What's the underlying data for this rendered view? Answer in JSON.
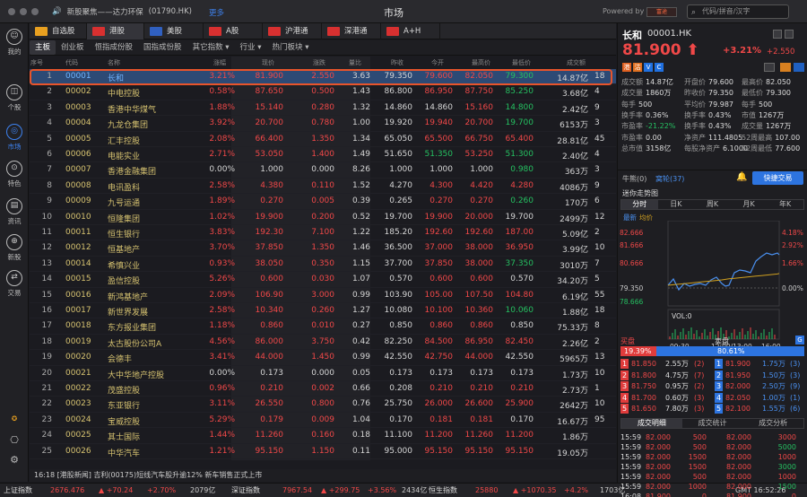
{
  "window": {
    "title": "市场",
    "ticker_prefix": "新股聚焦——",
    "ticker_name": "达力环保",
    "ticker_code": "(01790.HK)",
    "more": "更多",
    "powered": "Powered by",
    "brand": "富途",
    "search_placeholder": "代码/拼音/汉字"
  },
  "sidebar": [
    {
      "label": "我的",
      "icon": "avatar-icon"
    },
    {
      "label": "个股",
      "icon": "chart-icon"
    },
    {
      "label": "市场",
      "icon": "market-icon",
      "active": true
    },
    {
      "label": "特色",
      "icon": "special-icon"
    },
    {
      "label": "资讯",
      "icon": "news-icon"
    },
    {
      "label": "新股",
      "icon": "ipo-icon"
    },
    {
      "label": "交易",
      "icon": "trade-icon"
    }
  ],
  "market_tabs": [
    {
      "label": "自选股",
      "color": "#e8a020"
    },
    {
      "label": "港股",
      "color": "#d83030",
      "active": true
    },
    {
      "label": "美股",
      "color": "#3060c0"
    },
    {
      "label": "A股",
      "color": "#d83030"
    },
    {
      "label": "沪港通",
      "color": "#d83030"
    },
    {
      "label": "深港通",
      "color": "#d83030"
    },
    {
      "label": "A+H",
      "color": "#d83030"
    }
  ],
  "sub_tabs": [
    "主板",
    "创业板",
    "恒指成份股",
    "国指成份股",
    "其它指数 ▾",
    "行业 ▾",
    "热门板块 ▾"
  ],
  "table_headers": [
    "序号",
    "代码",
    "名称",
    "涨幅",
    "现价",
    "涨跌",
    "量比",
    "昨收",
    "今开",
    "最高价",
    "最低价",
    "成交额"
  ],
  "rows": [
    [
      "1",
      "00001",
      "长和",
      "3.21%",
      "81.900",
      "2.550",
      "3.63",
      "79.350",
      "79.600",
      "82.050",
      "79.300",
      "14.87亿",
      "18"
    ],
    [
      "2",
      "00002",
      "中电控股",
      "0.58%",
      "87.650",
      "0.500",
      "1.43",
      "86.800",
      "86.950",
      "87.750",
      "85.250",
      "3.68亿",
      "4"
    ],
    [
      "3",
      "00003",
      "香港中华煤气",
      "1.88%",
      "15.140",
      "0.280",
      "1.32",
      "14.860",
      "14.860",
      "15.160",
      "14.800",
      "2.42亿",
      "9"
    ],
    [
      "4",
      "00004",
      "九龙仓集团",
      "3.92%",
      "20.700",
      "0.780",
      "1.00",
      "19.920",
      "19.940",
      "20.700",
      "19.700",
      "6153万",
      "3"
    ],
    [
      "5",
      "00005",
      "汇丰控股",
      "2.08%",
      "66.400",
      "1.350",
      "1.34",
      "65.050",
      "65.500",
      "66.750",
      "65.400",
      "28.81亿",
      "45"
    ],
    [
      "6",
      "00006",
      "电能实业",
      "2.71%",
      "53.050",
      "1.400",
      "1.49",
      "51.650",
      "51.350",
      "53.250",
      "51.300",
      "2.40亿",
      "4"
    ],
    [
      "7",
      "00007",
      "香港金融集团",
      "0.00%",
      "1.000",
      "0.000",
      "8.26",
      "1.000",
      "1.000",
      "1.000",
      "0.980",
      "363万",
      "3"
    ],
    [
      "8",
      "00008",
      "电讯盈科",
      "2.58%",
      "4.380",
      "0.110",
      "1.52",
      "4.270",
      "4.300",
      "4.420",
      "4.280",
      "4086万",
      "9"
    ],
    [
      "9",
      "00009",
      "九号运通",
      "1.89%",
      "0.270",
      "0.005",
      "0.39",
      "0.265",
      "0.270",
      "0.270",
      "0.260",
      "170万",
      "6"
    ],
    [
      "10",
      "00010",
      "恒隆集团",
      "1.02%",
      "19.900",
      "0.200",
      "0.52",
      "19.700",
      "19.900",
      "20.000",
      "19.700",
      "2499万",
      "12"
    ],
    [
      "11",
      "00011",
      "恒生银行",
      "3.83%",
      "192.30",
      "7.100",
      "1.22",
      "185.20",
      "192.60",
      "192.60",
      "187.00",
      "5.09亿",
      "2"
    ],
    [
      "12",
      "00012",
      "恒基地产",
      "3.70%",
      "37.850",
      "1.350",
      "1.46",
      "36.500",
      "37.000",
      "38.000",
      "36.950",
      "3.99亿",
      "10"
    ],
    [
      "13",
      "00014",
      "希慎兴业",
      "0.93%",
      "38.050",
      "0.350",
      "1.15",
      "37.700",
      "37.850",
      "38.000",
      "37.350",
      "3010万",
      "7"
    ],
    [
      "14",
      "00015",
      "盈信控股",
      "5.26%",
      "0.600",
      "0.030",
      "1.07",
      "0.570",
      "0.600",
      "0.600",
      "0.570",
      "34.20万",
      "5"
    ],
    [
      "15",
      "00016",
      "新鸿基地产",
      "2.09%",
      "106.90",
      "3.000",
      "0.99",
      "103.90",
      "105.00",
      "107.50",
      "104.80",
      "6.19亿",
      "55"
    ],
    [
      "16",
      "00017",
      "新世界发展",
      "2.58%",
      "10.340",
      "0.260",
      "1.27",
      "10.080",
      "10.100",
      "10.360",
      "10.060",
      "1.88亿",
      "18"
    ],
    [
      "17",
      "00018",
      "东方报业集团",
      "1.18%",
      "0.860",
      "0.010",
      "0.27",
      "0.850",
      "0.860",
      "0.860",
      "0.850",
      "75.33万",
      "8"
    ],
    [
      "18",
      "00019",
      "太古股份公司A",
      "4.56%",
      "86.000",
      "3.750",
      "0.42",
      "82.250",
      "84.500",
      "86.950",
      "82.450",
      "2.26亿",
      "2"
    ],
    [
      "19",
      "00020",
      "会德丰",
      "3.41%",
      "44.000",
      "1.450",
      "0.99",
      "42.550",
      "42.750",
      "44.000",
      "42.550",
      "5965万",
      "13"
    ],
    [
      "20",
      "00021",
      "大中华地产控股",
      "0.00%",
      "0.173",
      "0.000",
      "0.05",
      "0.173",
      "0.173",
      "0.173",
      "0.173",
      "1.73万",
      "10"
    ],
    [
      "21",
      "00022",
      "茂盛控股",
      "0.96%",
      "0.210",
      "0.002",
      "0.66",
      "0.208",
      "0.210",
      "0.210",
      "0.210",
      "2.73万",
      "1"
    ],
    [
      "22",
      "00023",
      "东亚银行",
      "3.11%",
      "26.550",
      "0.800",
      "0.76",
      "25.750",
      "26.000",
      "26.600",
      "25.900",
      "2642万",
      "10"
    ],
    [
      "23",
      "00024",
      "宝威控股",
      "5.29%",
      "0.179",
      "0.009",
      "1.04",
      "0.170",
      "0.181",
      "0.181",
      "0.170",
      "16.67万",
      "95"
    ],
    [
      "24",
      "00025",
      "其士国际",
      "1.44%",
      "11.260",
      "0.160",
      "0.18",
      "11.100",
      "11.200",
      "11.260",
      "11.200",
      "1.86万",
      ""
    ],
    [
      "25",
      "00026",
      "中华汽车",
      "1.21%",
      "95.150",
      "1.150",
      "0.11",
      "95.000",
      "95.150",
      "95.150",
      "95.150",
      "19.05万",
      ""
    ]
  ],
  "news": "16:18 [港股新闻] 吉利(00175)短线汽车股升逾12% 新车销售正式上市",
  "status": [
    {
      "name": "上证指数",
      "value": "2676.476",
      "chg": "+70.24",
      "pct": "+2.70%",
      "amt": "2079亿"
    },
    {
      "name": "深证指数",
      "value": "7967.54",
      "chg": "+299.75",
      "pct": "+3.56%",
      "amt": "2434亿"
    },
    {
      "name": "恒生指数",
      "value": "25880",
      "chg": "+1070.35",
      "pct": "+4.2%",
      "amt": "1703亿"
    }
  ],
  "status_time": "GMT 16:52:26",
  "quote": {
    "name": "长和",
    "code": "00001.HK",
    "price": "81.900",
    "pct": "+3.21%",
    "chg": "+2.550",
    "stats": [
      [
        "成交额",
        "14.87亿"
      ],
      [
        "开盘价",
        "79.600"
      ],
      [
        "最高价",
        "82.050"
      ],
      [
        "成交量",
        "1860万"
      ],
      [
        "昨收价",
        "79.350"
      ],
      [
        "最低价",
        "79.300"
      ],
      [
        "每手",
        "500"
      ],
      [
        "平均价",
        "79.987"
      ],
      [
        "每手",
        "500"
      ],
      [
        "换手率",
        "0.36%"
      ],
      [
        "换手率",
        "0.43%"
      ],
      [
        "市值",
        "1267万"
      ],
      [
        "市盈率",
        "-21.22%"
      ],
      [
        "换手率",
        "0.43%"
      ],
      [
        "成交量",
        "1267万"
      ],
      [
        "市盈率",
        "0.00"
      ],
      [
        "净资产",
        "111.4805"
      ],
      [
        "52周最高",
        "107.00"
      ],
      [
        "总市值",
        "3158亿"
      ],
      [
        "每股净资产",
        "6.1000"
      ],
      [
        "52周最低",
        "77.600"
      ]
    ],
    "buttons": {
      "alert": "牛熊(0)",
      "warrants": "窝轮(37)",
      "fast_trade": "快捷交易"
    },
    "chart_title": "迷你走势图",
    "chart_tabs": [
      "分时",
      "日K",
      "周K",
      "月K",
      "年K"
    ],
    "chart_sub": [
      "最新",
      "均价"
    ],
    "chart_y": [
      "82.666",
      "81.666",
      "80.666",
      "79.350",
      "78.666"
    ],
    "chart_pct": [
      "4.18%",
      "2.92%",
      "1.66%",
      "0.00%"
    ],
    "vol": "VOL:0",
    "chart_x": [
      "09:30",
      "12:00/13:00",
      "16:00"
    ],
    "bid_ask": {
      "buy_label": "买盘",
      "sell_label": "卖盘",
      "buy_pct": "19.39%",
      "sell_pct": "80.61%"
    },
    "orderbook": [
      [
        "1",
        "81.850",
        "2.55万",
        "(2)",
        "1",
        "81.900",
        "1.75万",
        "(3)"
      ],
      [
        "2",
        "81.800",
        "4.75万",
        "(7)",
        "2",
        "81.950",
        "1.50万",
        "(3)"
      ],
      [
        "3",
        "81.750",
        "0.95万",
        "(2)",
        "3",
        "82.000",
        "2.50万",
        "(9)"
      ],
      [
        "4",
        "81.700",
        "0.60万",
        "(3)",
        "4",
        "82.050",
        "1.00万",
        "(1)"
      ],
      [
        "5",
        "81.650",
        "7.80万",
        "(3)",
        "5",
        "82.100",
        "1.55万",
        "(6)"
      ]
    ],
    "trade_tabs": [
      "成交明细",
      "成交统计",
      "成交分析"
    ],
    "ticks": [
      [
        "15:59",
        "82.000",
        "500",
        "3000"
      ],
      [
        "15:59",
        "82.000",
        "500",
        "5000"
      ],
      [
        "15:59",
        "82.000",
        "1500",
        "1000"
      ],
      [
        "15:59",
        "82.000",
        "1500",
        "3000"
      ],
      [
        "15:59",
        "82.000",
        "500",
        "1000"
      ],
      [
        "15:59",
        "82.000",
        "1000",
        "1500"
      ],
      [
        "16:08",
        "81.900",
        "0",
        "0"
      ]
    ]
  },
  "colors": {
    "up": "#f04848",
    "down": "#25c061",
    "accent": "#3d82f0",
    "highlight": "#e8542b"
  }
}
